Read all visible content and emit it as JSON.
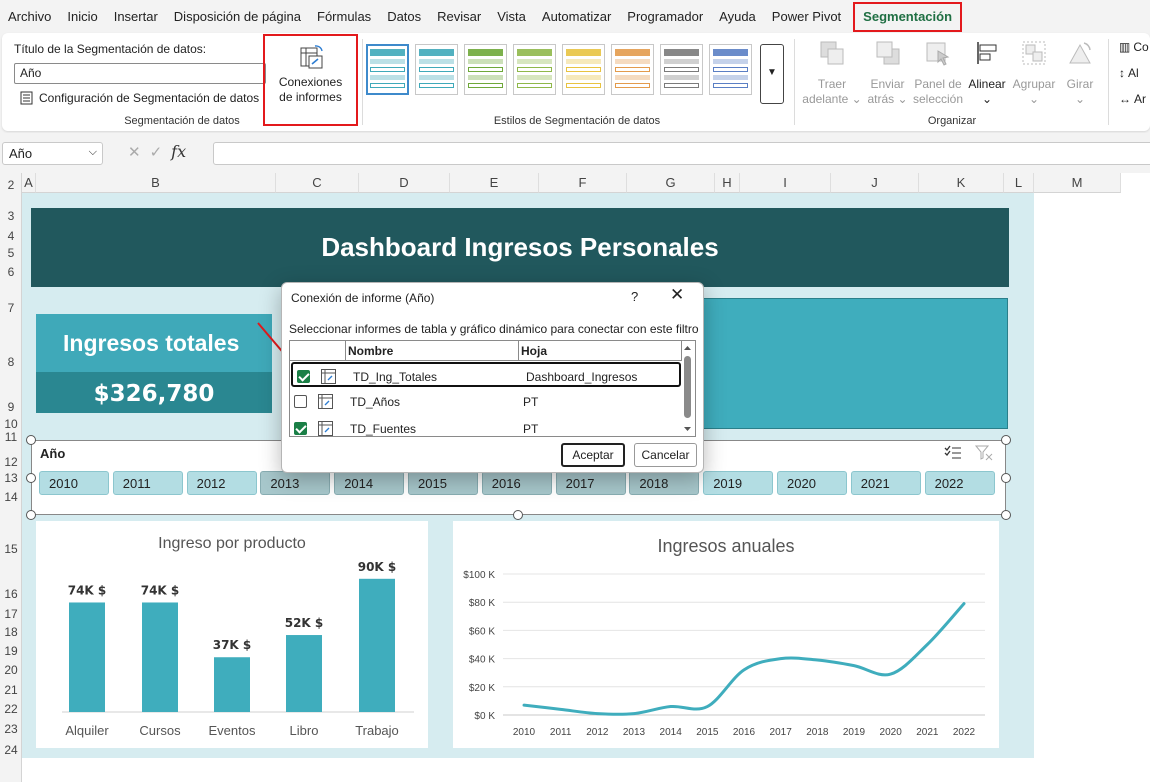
{
  "menu": {
    "items": [
      "Archivo",
      "Inicio",
      "Insertar",
      "Disposición de página",
      "Fórmulas",
      "Datos",
      "Revisar",
      "Vista",
      "Automatizar",
      "Programador",
      "Ayuda",
      "Power Pivot"
    ],
    "active": "Segmentación"
  },
  "ribbon": {
    "slicer_group": {
      "title_label": "Título de la Segmentación de datos:",
      "title_value": "Año",
      "settings_label": "Configuración de Segmentación de datos",
      "group_label": "Segmentación de datos"
    },
    "connections": {
      "line1": "Conexiones",
      "line2": "de informes"
    },
    "styles_group_label": "Estilos de Segmentación de datos",
    "style_colors": [
      "#3fa9b9",
      "#3fa9b9",
      "#6fa83a",
      "#8fb84a",
      "#e8c341",
      "#e39b4c",
      "#7b7b7b",
      "#5b7fc4"
    ],
    "arrange": {
      "bring_forward": [
        "Traer",
        "adelante"
      ],
      "send_backward": [
        "Enviar",
        "atrás"
      ],
      "selection_pane": [
        "Panel de",
        "selección"
      ],
      "align": "Alinear",
      "group": "Agrupar",
      "rotate": "Girar",
      "group_label": "Organizar"
    },
    "side_buttons": [
      "Co",
      "Al",
      "Ar"
    ]
  },
  "formula_bar": {
    "name_box": "Año",
    "fx": "fx",
    "formula": ""
  },
  "grid": {
    "columns": [
      "A",
      "B",
      "C",
      "D",
      "E",
      "F",
      "G",
      "H",
      "I",
      "J",
      "K",
      "L",
      "M"
    ],
    "rows": [
      "2",
      "3",
      "4",
      "5",
      "6",
      "7",
      "8",
      "9",
      "10",
      "11",
      "12",
      "13",
      "14",
      "15",
      "16",
      "17",
      "18",
      "19",
      "20",
      "21",
      "22",
      "23",
      "24"
    ]
  },
  "dashboard": {
    "title": "Dashboard Ingresos Personales",
    "kpi_title": "Ingresos totales",
    "kpi_value": "$326,780"
  },
  "slicer": {
    "header": "Año",
    "years": [
      "2010",
      "2011",
      "2012",
      "2013",
      "2014",
      "2015",
      "2016",
      "2017",
      "2018",
      "2019",
      "2020",
      "2021",
      "2022"
    ],
    "dim_years": [
      "2013",
      "2014",
      "2015",
      "2016",
      "2017",
      "2018"
    ]
  },
  "dialog": {
    "title": "Conexión de informe (Año)",
    "help": "?",
    "close": "✕",
    "instruction": "Seleccionar informes de tabla y gráfico dinámico para conectar con este filtro",
    "col_name": "Nombre",
    "col_sheet": "Hoja",
    "rows": [
      {
        "name": "TD_Ing_Totales",
        "sheet": "Dashboard_Ingresos",
        "checked": true
      },
      {
        "name": "TD_Años",
        "sheet": "PT",
        "checked": false
      },
      {
        "name": "TD_Fuentes",
        "sheet": "PT",
        "checked": true
      }
    ],
    "ok": "Aceptar",
    "cancel": "Cancelar"
  },
  "chart_data": [
    {
      "type": "bar",
      "title": "Ingreso por producto",
      "categories": [
        "Alquiler",
        "Cursos",
        "Eventos",
        "Libro",
        "Trabajo"
      ],
      "values": [
        74,
        74,
        37,
        52,
        90
      ],
      "data_labels": [
        "74K $",
        "74K $",
        "37K $",
        "52K $",
        "90K $"
      ],
      "ylim": [
        0,
        100
      ],
      "color": "#3fadbd"
    },
    {
      "type": "line",
      "title": "Ingresos anuales",
      "x": [
        "2010",
        "2011",
        "2012",
        "2013",
        "2014",
        "2015",
        "2016",
        "2017",
        "2018",
        "2019",
        "2020",
        "2021",
        "2022"
      ],
      "values": [
        7,
        4,
        1,
        1,
        6,
        6,
        32,
        40,
        39,
        35,
        29,
        50,
        79
      ],
      "ylim": [
        0,
        100
      ],
      "yticks": [
        "$0 K",
        "$20 K",
        "$40 K",
        "$60 K",
        "$80 K",
        "$100 K"
      ],
      "color": "#3fadbd",
      "grid": true
    }
  ]
}
